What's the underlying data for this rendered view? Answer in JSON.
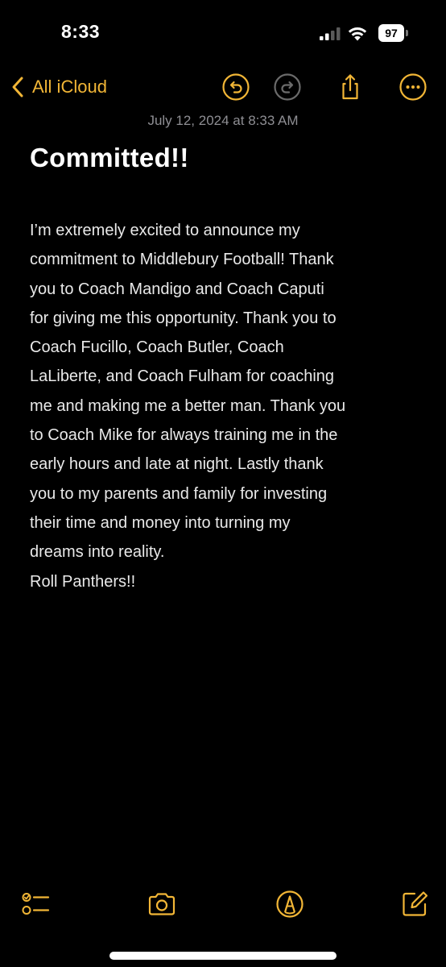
{
  "status_bar": {
    "time": "8:33",
    "battery_level": "97",
    "icons": [
      "cellular-signal-icon",
      "wifi-icon",
      "battery-icon"
    ]
  },
  "nav": {
    "back_label": "All iCloud",
    "icons": [
      "chevron-left-icon",
      "undo-icon",
      "redo-icon",
      "share-icon",
      "more-icon"
    ]
  },
  "note": {
    "date": "July 12, 2024 at 8:33 AM",
    "title": "Committed!!",
    "body_lines": [
      "I’m extremely excited to announce my",
      "commitment to Middlebury Football! Thank",
      "you to Coach Mandigo and Coach Caputi",
      "for giving me this opportunity. Thank you to",
      "Coach Fucillo, Coach Butler, Coach",
      "LaLiberte, and Coach Fulham for coaching",
      "me and making me a better man. Thank you",
      "to Coach Mike for always training me in the",
      "early hours and late at night. Lastly thank",
      "you to my parents and family for investing",
      "their time and money into turning my",
      "dreams into reality.",
      "Roll Panthers!!"
    ]
  },
  "toolbar": {
    "icons": [
      "checklist-icon",
      "camera-icon",
      "markup-icon",
      "compose-icon"
    ]
  },
  "colors": {
    "accent": "#f2b636",
    "background": "#000000",
    "text": "#e9e9e9",
    "secondary_text": "#8e8e93",
    "disabled_icon": "#6b6b6b"
  }
}
